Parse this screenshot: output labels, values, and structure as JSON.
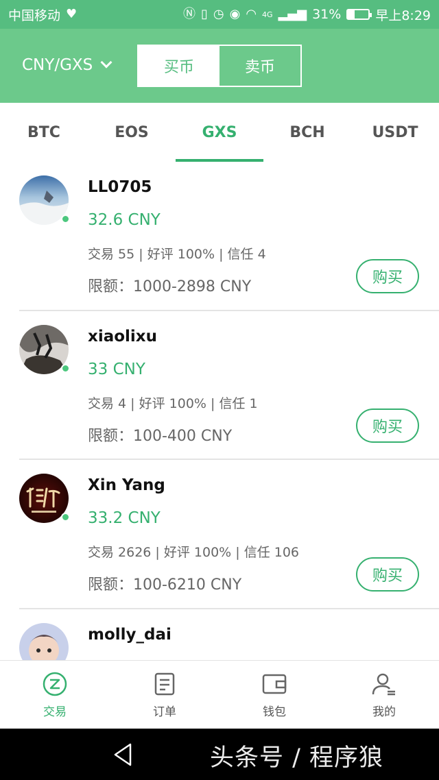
{
  "status_bar": {
    "carrier": "中国移动",
    "battery_percent": "31%",
    "battery_level": 0.31,
    "time": "早上8:29",
    "network": "4G"
  },
  "header": {
    "pair_label": "CNY/GXS",
    "buy_label": "买币",
    "sell_label": "卖币"
  },
  "tabs": [
    {
      "label": "BTC"
    },
    {
      "label": "EOS"
    },
    {
      "label": "GXS"
    },
    {
      "label": "BCH"
    },
    {
      "label": "USDT"
    }
  ],
  "active_tab": "GXS",
  "offers": [
    {
      "name": "LL0705",
      "price": "32.6 CNY",
      "stats": "交易 55 | 好评 100% | 信任 4",
      "limit": "限额：1000-2898 CNY",
      "button": "购买"
    },
    {
      "name": "xiaolixu",
      "price": "33 CNY",
      "stats": "交易 4 | 好评 100% | 信任 1",
      "limit": "限额：100-400 CNY",
      "button": "购买"
    },
    {
      "name": "Xin Yang",
      "price": "33.2 CNY",
      "stats": "交易 2626 | 好评 100% | 信任 106",
      "limit": "限额：100-6210 CNY",
      "button": "购买"
    },
    {
      "name": "molly_dai",
      "price": "",
      "stats": "",
      "limit": "",
      "button": ""
    }
  ],
  "bottom_nav": [
    {
      "label": "交易"
    },
    {
      "label": "订单"
    },
    {
      "label": "钱包"
    },
    {
      "label": "我的"
    }
  ],
  "watermark": "头条号 / 程序狼",
  "colors": {
    "header_green": "#6cc98b",
    "status_green": "#56bd80",
    "accent_green": "#35b06f"
  }
}
